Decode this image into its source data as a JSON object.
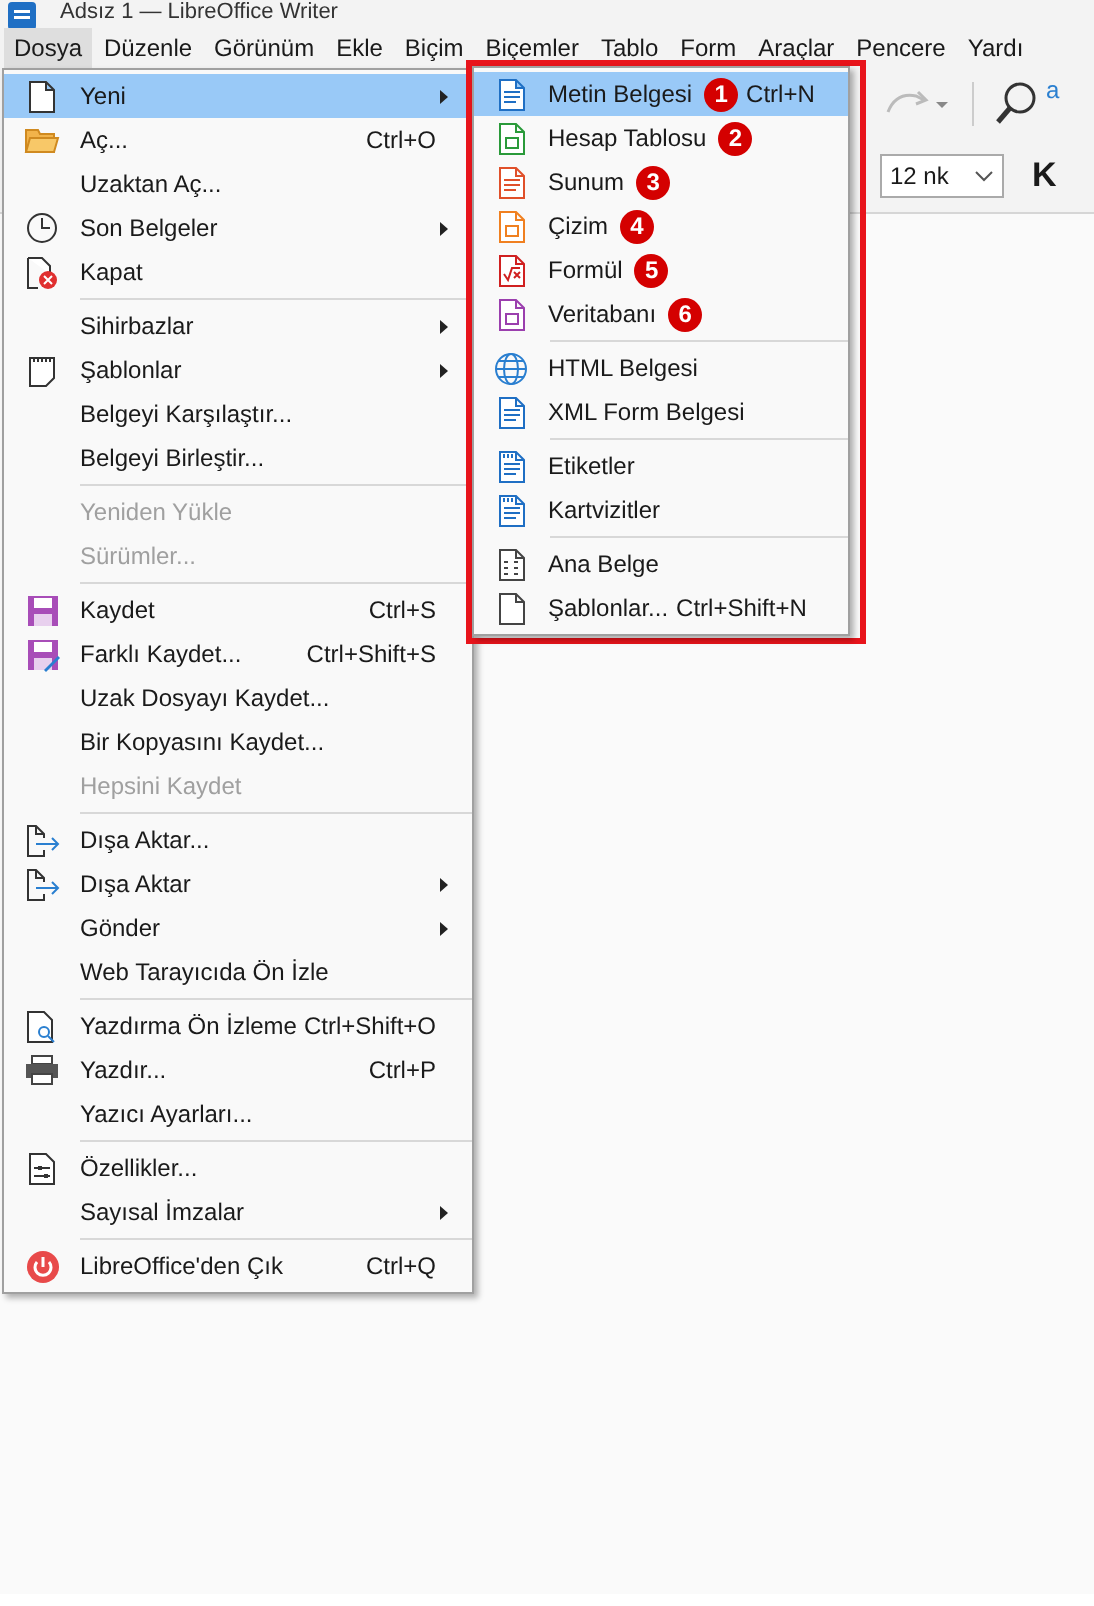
{
  "window": {
    "title": "Adsız 1 — LibreOffice Writer"
  },
  "menubar": [
    {
      "label": "Dosya",
      "selected": true
    },
    {
      "label": "Düzenle",
      "selected": false
    },
    {
      "label": "Görünüm",
      "selected": false
    },
    {
      "label": "Ekle",
      "selected": false
    },
    {
      "label": "Biçim",
      "selected": false
    },
    {
      "label": "Biçemler",
      "selected": false
    },
    {
      "label": "Tablo",
      "selected": false
    },
    {
      "label": "Form",
      "selected": false
    },
    {
      "label": "Araçlar",
      "selected": false
    },
    {
      "label": "Pencere",
      "selected": false
    },
    {
      "label": "Yardı",
      "selected": false
    }
  ],
  "toolbar": {
    "find_letter": "a",
    "font_size": "12 nk",
    "bold": "K"
  },
  "file_menu": [
    {
      "kind": "item",
      "label": "Yeni",
      "submenu": true,
      "selected": true,
      "disabled": false
    },
    {
      "kind": "item",
      "label": "Aç...",
      "shortcut": "Ctrl+O",
      "selected": false,
      "disabled": false
    },
    {
      "kind": "item",
      "label": "Uzaktan Aç...",
      "selected": false,
      "disabled": false
    },
    {
      "kind": "item",
      "label": "Son Belgeler",
      "submenu": true,
      "selected": false,
      "disabled": false
    },
    {
      "kind": "item",
      "label": "Kapat",
      "selected": false,
      "disabled": false
    },
    {
      "kind": "separator"
    },
    {
      "kind": "item",
      "label": "Sihirbazlar",
      "submenu": true,
      "selected": false,
      "disabled": false
    },
    {
      "kind": "item",
      "label": "Şablonlar",
      "submenu": true,
      "selected": false,
      "disabled": false
    },
    {
      "kind": "item",
      "label": "Belgeyi Karşılaştır...",
      "selected": false,
      "disabled": false
    },
    {
      "kind": "item",
      "label": "Belgeyi Birleştir...",
      "selected": false,
      "disabled": false
    },
    {
      "kind": "separator"
    },
    {
      "kind": "item",
      "label": "Yeniden Yükle",
      "selected": false,
      "disabled": true
    },
    {
      "kind": "item",
      "label": "Sürümler...",
      "selected": false,
      "disabled": true
    },
    {
      "kind": "separator"
    },
    {
      "kind": "item",
      "label": "Kaydet",
      "shortcut": "Ctrl+S",
      "selected": false,
      "disabled": false
    },
    {
      "kind": "item",
      "label": "Farklı Kaydet...",
      "shortcut": "Ctrl+Shift+S",
      "selected": false,
      "disabled": false
    },
    {
      "kind": "item",
      "label": "Uzak Dosyayı Kaydet...",
      "selected": false,
      "disabled": false
    },
    {
      "kind": "item",
      "label": "Bir Kopyasını Kaydet...",
      "selected": false,
      "disabled": false
    },
    {
      "kind": "item",
      "label": "Hepsini Kaydet",
      "selected": false,
      "disabled": true
    },
    {
      "kind": "separator"
    },
    {
      "kind": "item",
      "label": "Dışa Aktar...",
      "selected": false,
      "disabled": false
    },
    {
      "kind": "item",
      "label": "Dışa Aktar",
      "submenu": true,
      "selected": false,
      "disabled": false
    },
    {
      "kind": "item",
      "label": "Gönder",
      "submenu": true,
      "selected": false,
      "disabled": false
    },
    {
      "kind": "item",
      "label": "Web Tarayıcıda Ön İzle",
      "selected": false,
      "disabled": false
    },
    {
      "kind": "separator"
    },
    {
      "kind": "item",
      "label": "Yazdırma Ön İzleme",
      "shortcut": "Ctrl+Shift+O",
      "selected": false,
      "disabled": false
    },
    {
      "kind": "item",
      "label": "Yazdır...",
      "shortcut": "Ctrl+P",
      "selected": false,
      "disabled": false
    },
    {
      "kind": "item",
      "label": "Yazıcı Ayarları...",
      "selected": false,
      "disabled": false
    },
    {
      "kind": "separator"
    },
    {
      "kind": "item",
      "label": "Özellikler...",
      "selected": false,
      "disabled": false
    },
    {
      "kind": "item",
      "label": "Sayısal İmzalar",
      "submenu": true,
      "selected": false,
      "disabled": false
    },
    {
      "kind": "separator"
    },
    {
      "kind": "item",
      "label": "LibreOffice'den Çık",
      "shortcut": "Ctrl+Q",
      "selected": false,
      "disabled": false
    }
  ],
  "new_submenu": [
    {
      "kind": "item",
      "label": "Metin Belgesi",
      "badge": "1",
      "shortcut": "Ctrl+N",
      "selected": true
    },
    {
      "kind": "item",
      "label": "Hesap Tablosu",
      "badge": "2",
      "selected": false
    },
    {
      "kind": "item",
      "label": "Sunum",
      "badge": "3",
      "selected": false
    },
    {
      "kind": "item",
      "label": "Çizim",
      "badge": "4",
      "selected": false
    },
    {
      "kind": "item",
      "label": "Formül",
      "badge": "5",
      "selected": false
    },
    {
      "kind": "item",
      "label": "Veritabanı",
      "badge": "6",
      "selected": false
    },
    {
      "kind": "separator"
    },
    {
      "kind": "item",
      "label": "HTML Belgesi",
      "selected": false
    },
    {
      "kind": "item",
      "label": "XML Form Belgesi",
      "selected": false
    },
    {
      "kind": "separator"
    },
    {
      "kind": "item",
      "label": "Etiketler",
      "selected": false
    },
    {
      "kind": "item",
      "label": "Kartvizitler",
      "selected": false
    },
    {
      "kind": "separator"
    },
    {
      "kind": "item",
      "label": "Ana Belge",
      "selected": false
    },
    {
      "kind": "item",
      "label": "Şablonlar...",
      "shortcut": "Ctrl+Shift+N",
      "selected": false
    }
  ]
}
